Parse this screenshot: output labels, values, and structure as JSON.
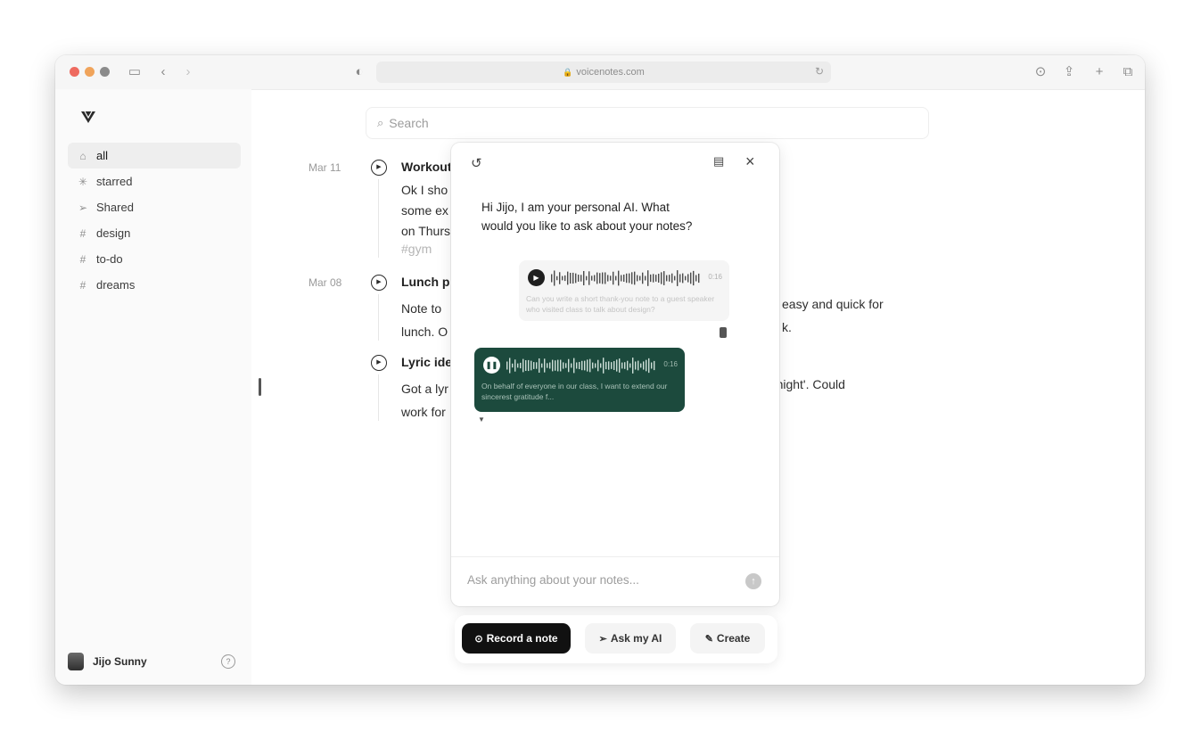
{
  "browser": {
    "url": "voicenotes.com"
  },
  "sidebar": {
    "items": [
      {
        "label": "all",
        "icon": "inbox-icon",
        "glyph": "⌂",
        "active": true
      },
      {
        "label": "starred",
        "icon": "star-icon",
        "glyph": "✳",
        "active": false
      },
      {
        "label": "Shared",
        "icon": "send-icon",
        "glyph": "➢",
        "active": false
      },
      {
        "label": "design",
        "icon": "hash-icon",
        "glyph": "#",
        "active": false
      },
      {
        "label": "to-do",
        "icon": "hash-icon",
        "glyph": "#",
        "active": false
      },
      {
        "label": "dreams",
        "icon": "hash-icon",
        "glyph": "#",
        "active": false
      }
    ],
    "user_name": "Jijo Sunny"
  },
  "search": {
    "placeholder": "Search"
  },
  "notes": [
    {
      "date": "Mar 11",
      "title": "Workout",
      "lines": [
        "Ok I sho",
        "some ex",
        "on Thurs"
      ],
      "tag": "#gym"
    },
    {
      "date": "Mar 08",
      "title": "Lunch p",
      "lines": [
        "Note to",
        "lunch. O"
      ],
      "trailing": [
        "easy and quick for",
        "k."
      ]
    },
    {
      "title": "Lyric ide",
      "lines": [
        "Got a lyr",
        "work for"
      ],
      "trailing": [
        "et night'. Could"
      ]
    }
  ],
  "ai_panel": {
    "greeting": "Hi Jijo, I am your personal AI. What would you like to ask about your notes?",
    "user_message": {
      "duration": "0:16",
      "text": "Can you write a short thank-you note to a guest speaker who visited class to talk about design?"
    },
    "ai_message": {
      "duration": "0:16",
      "text": "On behalf of everyone in our class, I want to extend our sincerest gratitude f..."
    },
    "input_placeholder": "Ask anything about your notes..."
  },
  "actions": {
    "record": "Record a note",
    "ask": "Ask my AI",
    "create": "Create"
  },
  "colors": {
    "accent_green": "#1c4a3d",
    "dark_button": "#111111"
  }
}
